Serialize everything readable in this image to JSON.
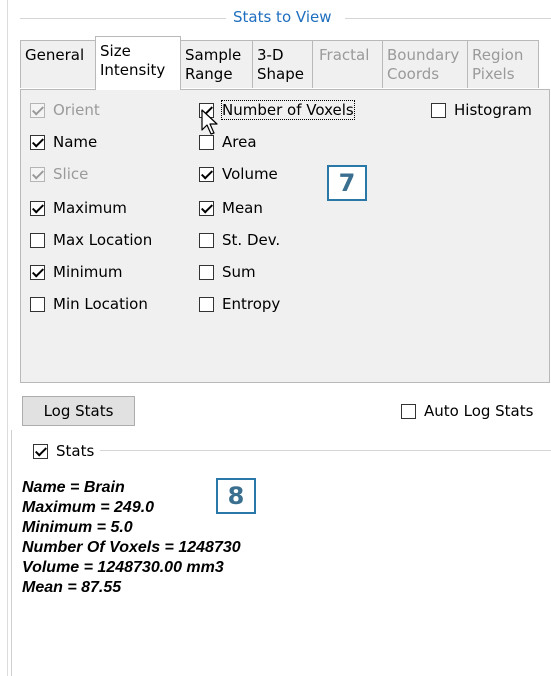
{
  "group_title": "Stats to View",
  "tabs": [
    {
      "line1": "General",
      "line2": "",
      "active": false,
      "disabled": false
    },
    {
      "line1": "Size",
      "line2": "Intensity",
      "active": true,
      "disabled": false
    },
    {
      "line1": "Sample",
      "line2": "Range",
      "active": false,
      "disabled": false
    },
    {
      "line1": "3-D",
      "line2": "Shape",
      "active": false,
      "disabled": false
    },
    {
      "line1": "Fractal",
      "line2": "",
      "active": false,
      "disabled": true
    },
    {
      "line1": "Boundary",
      "line2": "Coords",
      "active": false,
      "disabled": true
    },
    {
      "line1": "Region",
      "line2": "Pixels",
      "active": false,
      "disabled": true
    }
  ],
  "checkboxes": {
    "orient": {
      "label": "Orient",
      "checked": true,
      "disabled": true
    },
    "name": {
      "label": "Name",
      "checked": true,
      "disabled": false
    },
    "slice": {
      "label": "Slice",
      "checked": true,
      "disabled": true
    },
    "maximum": {
      "label": "Maximum",
      "checked": true,
      "disabled": false
    },
    "max_location": {
      "label": "Max Location",
      "checked": false,
      "disabled": false
    },
    "minimum": {
      "label": "Minimum",
      "checked": true,
      "disabled": false
    },
    "min_location": {
      "label": "Min Location",
      "checked": false,
      "disabled": false
    },
    "number_of_voxels": {
      "label": "Number of Voxels",
      "checked": true,
      "disabled": false
    },
    "area": {
      "label": "Area",
      "checked": false,
      "disabled": false
    },
    "volume": {
      "label": "Volume",
      "checked": true,
      "disabled": false
    },
    "mean": {
      "label": "Mean",
      "checked": true,
      "disabled": false
    },
    "st_dev": {
      "label": "St. Dev.",
      "checked": false,
      "disabled": false
    },
    "sum": {
      "label": "Sum",
      "checked": false,
      "disabled": false
    },
    "entropy": {
      "label": "Entropy",
      "checked": false,
      "disabled": false
    },
    "histogram": {
      "label": "Histogram",
      "checked": false,
      "disabled": false
    },
    "auto_log_stats": {
      "label": "Auto Log Stats",
      "checked": false,
      "disabled": false
    },
    "stats": {
      "label": "Stats",
      "checked": true,
      "disabled": false
    }
  },
  "log_stats_label": "Log Stats",
  "callouts": {
    "first": "7",
    "second": "8"
  },
  "output_lines": [
    "Name = Brain",
    "Maximum = 249.0",
    "Minimum = 5.0",
    "Number Of Voxels = 1248730",
    "Volume = 1248730.00 mm3",
    "Mean = 87.55"
  ],
  "colors": {
    "accent": "#1f6fbf",
    "callout_border": "#2a78a8"
  }
}
